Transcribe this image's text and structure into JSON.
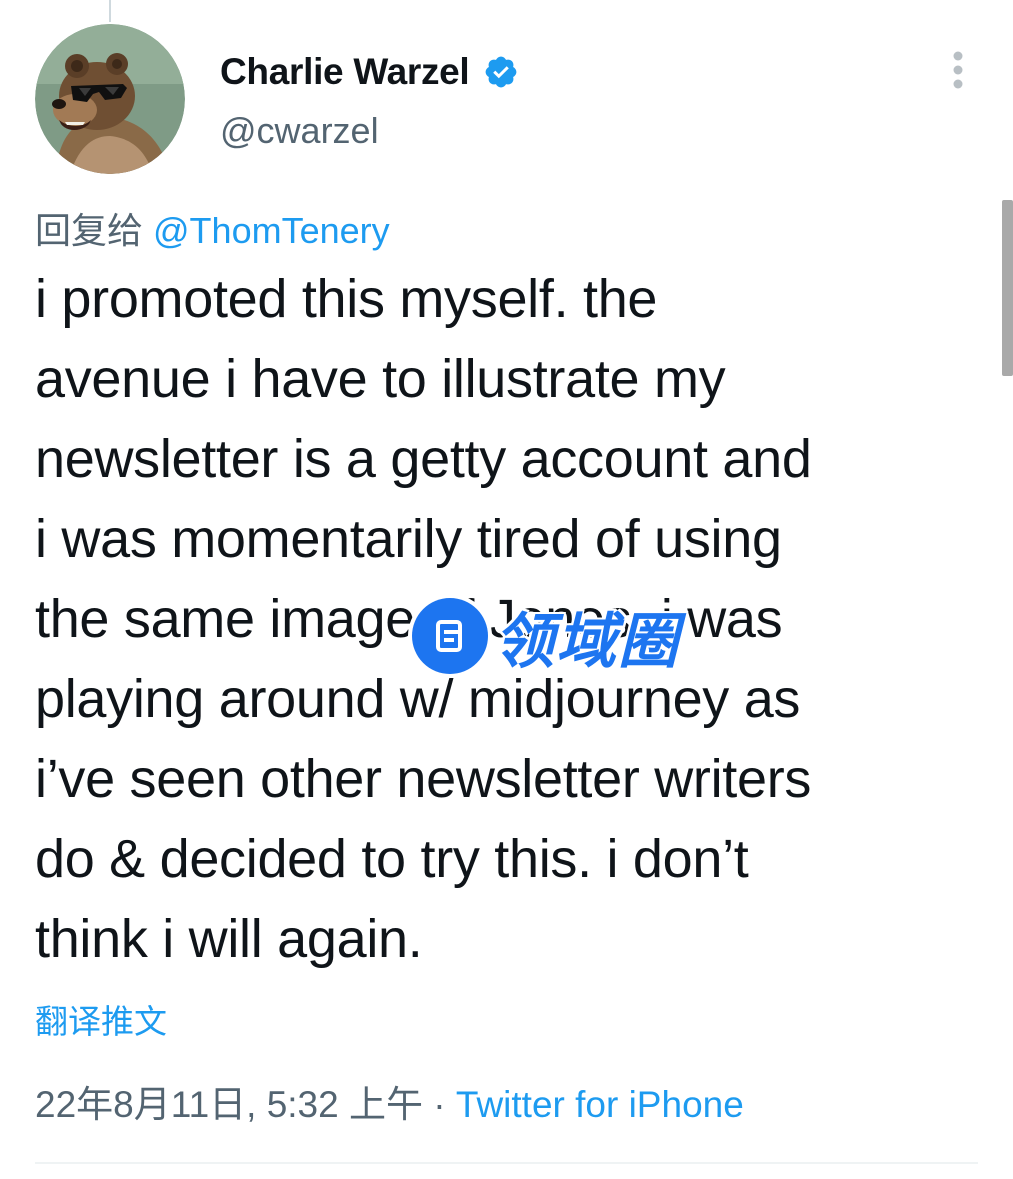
{
  "author": {
    "name": "Charlie Warzel",
    "handle": "@cwarzel",
    "verified": true
  },
  "icons": {
    "avatar": "bear-with-sunglasses-avatar",
    "verified": "verified-badge-icon",
    "more": "more-vertical-icon",
    "watermark": "document-icon"
  },
  "reply": {
    "prefix": "回复给",
    "mention": "@ThomTenery"
  },
  "tweet": {
    "lines": [
      "i promoted this myself. the",
      "avenue i have to illustrate my",
      "newsletter is a getty account and",
      "i was momentarily tired of using",
      "the same image of Jones. i was",
      "playing around w/ midjourney as",
      "i’ve seen other newsletter writers",
      "do & decided to try this. i don’t",
      "think i will again."
    ]
  },
  "watermark": {
    "text": "领域圈"
  },
  "translate_label": "翻译推文",
  "meta": {
    "timestamp": "22年8月11日, 5:32 上午",
    "separator": " · ",
    "source": "Twitter for iPhone"
  },
  "colors": {
    "text": "#0f1419",
    "muted": "#536471",
    "link": "#1d9bf0",
    "watermark": "#1d75f0"
  }
}
